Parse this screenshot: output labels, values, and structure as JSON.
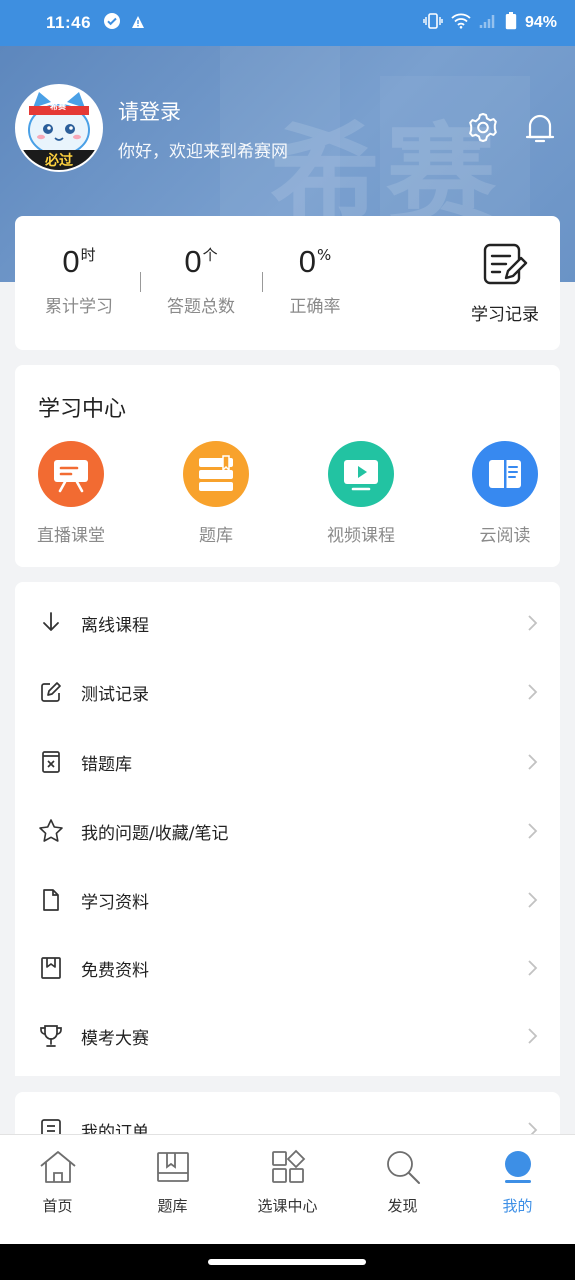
{
  "status_bar": {
    "time": "11:46",
    "battery": "94%",
    "icons": [
      "check-circle-icon",
      "warning-icon",
      "vibrate-icon",
      "wifi-icon",
      "signal-icon",
      "battery-icon"
    ]
  },
  "header": {
    "watermark": "希赛",
    "avatar_badge": "必过",
    "avatar_band": "希赛",
    "user_name": "请登录",
    "greeting": "你好，欢迎来到希赛网",
    "icons": [
      "settings-icon",
      "bell-icon"
    ]
  },
  "stats": {
    "items": [
      {
        "value": "0",
        "unit": "时",
        "label": "累计学习"
      },
      {
        "value": "0",
        "unit": "个",
        "label": "答题总数"
      },
      {
        "value": "0",
        "unit": "%",
        "label": "正确率"
      }
    ],
    "record_label": "学习记录",
    "record_icon": "edit-note-icon"
  },
  "learning_center": {
    "title": "学习中心",
    "items": [
      {
        "label": "直播课堂",
        "icon": "presentation-icon",
        "color": "#f26b32"
      },
      {
        "label": "题库",
        "icon": "question-bank-icon",
        "color": "#f8a22c"
      },
      {
        "label": "视频课程",
        "icon": "video-icon",
        "color": "#22c3a2"
      },
      {
        "label": "云阅读",
        "icon": "book-icon",
        "color": "#3789f0"
      }
    ]
  },
  "menu": {
    "items": [
      {
        "label": "离线课程",
        "icon": "download-icon"
      },
      {
        "label": "测试记录",
        "icon": "pencil-square-icon"
      },
      {
        "label": "错题库",
        "icon": "wrong-bank-icon"
      },
      {
        "label": "我的问题/收藏/笔记",
        "icon": "star-icon"
      },
      {
        "label": "学习资料",
        "icon": "document-icon"
      },
      {
        "label": "免费资料",
        "icon": "bookmark-icon"
      },
      {
        "label": "模考大赛",
        "icon": "trophy-icon"
      }
    ],
    "partial_item": {
      "label": "我的订单",
      "icon": "order-icon"
    }
  },
  "bottom_nav": {
    "items": [
      {
        "label": "首页",
        "icon": "home-icon",
        "active": false
      },
      {
        "label": "题库",
        "icon": "question-bank-icon",
        "active": false
      },
      {
        "label": "选课中心",
        "icon": "grid-icon",
        "active": false
      },
      {
        "label": "发现",
        "icon": "search-icon",
        "active": false
      },
      {
        "label": "我的",
        "icon": "profile-icon",
        "active": true
      }
    ],
    "active_color": "#3d8fe6"
  },
  "colors": {
    "status_bar": "#3e8fe0",
    "header": "#6a93c6",
    "accent": "#3d8fe6"
  }
}
